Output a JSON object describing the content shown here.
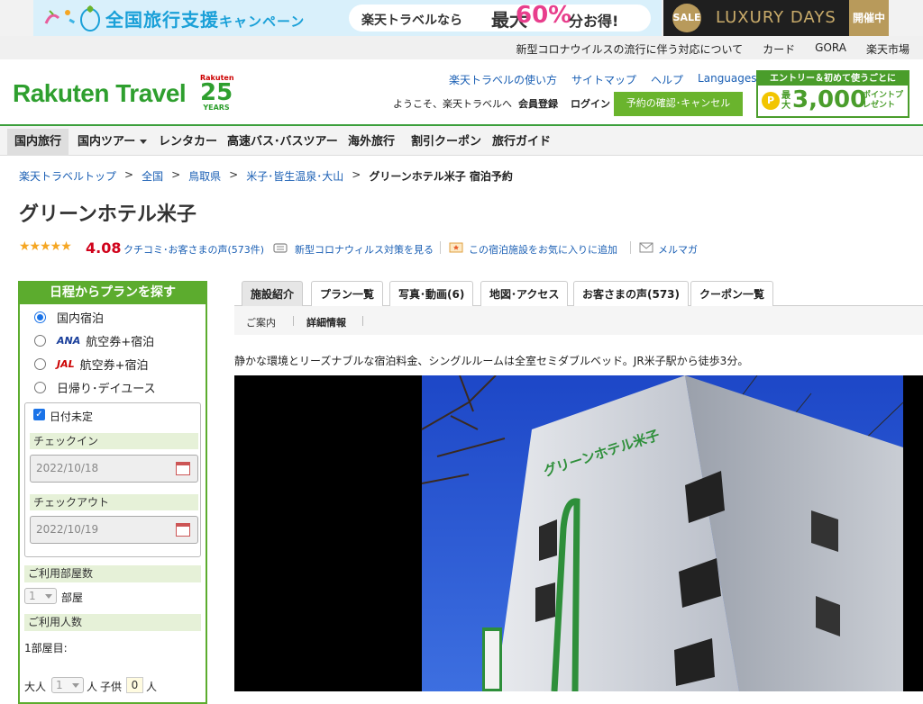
{
  "promo": {
    "title_main": "全国旅行支援",
    "title_sub": "キャンペーン",
    "pill_text": "楽天トラベルなら",
    "pill_max": "最大",
    "pill_pct": "60%",
    "pill_tail": "分お得!",
    "sale_badge": "SALE",
    "luxury": "LUXURY DAYS",
    "luxury_tag": "開催中"
  },
  "utility": {
    "links": [
      "新型コロナウイルスの流行に伴う対応について",
      "カード",
      "GORA",
      "楽天市場"
    ]
  },
  "header": {
    "logo": "Rakuten Travel",
    "anniv_top": "Rakuten",
    "anniv_num": "25",
    "anniv_years": "YEARS",
    "links": [
      "楽天トラベルの使い方",
      "サイトマップ",
      "ヘルプ",
      "Languages"
    ],
    "welcome": "ようこそ、楽天トラベルへ",
    "register": "会員登録",
    "login": "ログイン",
    "confirm_button": "予約の確認･キャンセル",
    "entry_top": "エントリー＆初めて使うごとに",
    "entry_coin": "P",
    "entry_pre": "最大",
    "entry_amount": "3,000",
    "entry_tail": "ポイントプレゼント"
  },
  "nav": {
    "items": [
      "国内旅行",
      "国内ツアー",
      "レンタカー",
      "高速バス･バスツアー",
      "海外旅行",
      "割引クーポン",
      "旅行ガイド"
    ]
  },
  "breadcrumb": {
    "items": [
      "楽天トラベルトップ",
      "全国",
      "鳥取県",
      "米子･皆生温泉･大山"
    ],
    "separator": ">",
    "current": "グリーンホテル米子 宿泊予約"
  },
  "hotel": {
    "name": "グリーンホテル米子",
    "stars": "★★★★★",
    "score": "4.08",
    "reviews_link": "クチコミ･お客さまの声(573件)",
    "covid_link": "新型コロナウィルス対策を見る",
    "favorite_link": "この宿泊施設をお気に入りに追加",
    "mail_link": "メルマガ",
    "description": "静かな環境とリーズナブルな宿泊料金、シングルルームは全室セミダブルベッド。JR米子駅から徒歩3分。"
  },
  "search": {
    "heading": "日程からプランを探す",
    "options": [
      {
        "label": "国内宿泊",
        "selected": true
      },
      {
        "label": "航空券+宿泊",
        "airline": "ANA",
        "selected": false
      },
      {
        "label": "航空券+宿泊",
        "airline": "JAL",
        "selected": false
      },
      {
        "label": "日帰り･デイユース",
        "selected": false
      }
    ],
    "date_undecided": "日付未定",
    "checkin_label": "チェックイン",
    "checkin_value": "2022/10/18",
    "checkout_label": "チェックアウト",
    "checkout_value": "2022/10/19",
    "rooms_label": "ご利用部屋数",
    "rooms_value": "1",
    "rooms_unit": "部屋",
    "people_label": "ご利用人数",
    "room1_label": "1部屋目:",
    "adult_label": "大人",
    "adult_value": "1",
    "adult_unit": "人",
    "child_label": "子供",
    "child_value": "0",
    "child_unit": "人"
  },
  "tabs": {
    "items": [
      "施設紹介",
      "プラン一覧",
      "写真･動画(6)",
      "地図･アクセス",
      "お客さまの声(573)",
      "クーポン一覧"
    ],
    "active": 0
  },
  "subtabs": {
    "items": [
      "ご案内",
      "詳細情報"
    ]
  },
  "photo": {
    "sign_text": "グリーンホテル米子"
  },
  "colors": {
    "brand_green": "#2e9f2e",
    "accent_red": "#d0021b",
    "link_blue": "#1a5fb4"
  }
}
